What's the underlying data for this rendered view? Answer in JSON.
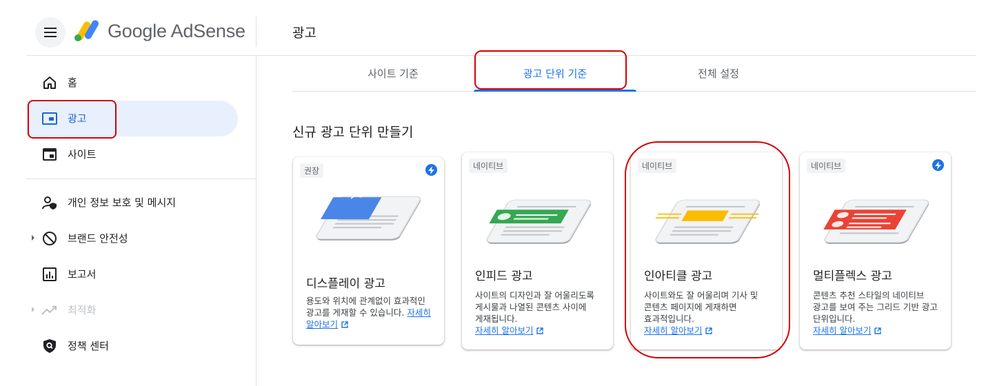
{
  "header": {
    "brand": "Google AdSense",
    "page_title": "광고"
  },
  "sidebar": {
    "items": [
      {
        "label": "홈",
        "icon": "home-icon",
        "active": false
      },
      {
        "label": "광고",
        "icon": "ads-icon",
        "active": true
      },
      {
        "label": "사이트",
        "icon": "sites-icon",
        "active": false
      },
      {
        "label": "개인 정보 보호 및 메시지",
        "icon": "privacy-icon",
        "active": false
      },
      {
        "label": "브랜드 안전성",
        "icon": "block-icon",
        "active": false
      },
      {
        "label": "보고서",
        "icon": "reports-icon",
        "active": false
      },
      {
        "label": "최적화",
        "icon": "trending-icon",
        "active": false,
        "disabled": true
      },
      {
        "label": "정책 센터",
        "icon": "policy-shield-icon",
        "active": false
      }
    ]
  },
  "tabs": [
    {
      "label": "사이트 기준",
      "active": false
    },
    {
      "label": "광고 단위 기준",
      "active": true
    },
    {
      "label": "전체 설정",
      "active": false
    }
  ],
  "section_title": "신규 광고 단위 만들기",
  "cards": [
    {
      "badge": "권장",
      "lightning": true,
      "title": "디스플레이 광고",
      "description": "용도와 위치에 관계없이 효과적인 광고를 게재할 수 있습니다.",
      "link": "자세히 알아보기",
      "accent": "#4a86e8"
    },
    {
      "badge": "네이티브",
      "lightning": false,
      "title": "인피드 광고",
      "description": "사이트의 디자인과 잘 어울리도록 게시물과 나열된 콘텐츠 사이에 게재됩니다.",
      "link": "자세히 알아보기",
      "accent": "#34a853"
    },
    {
      "badge": "네이티브",
      "lightning": false,
      "title": "인아티클 광고",
      "description": "사이트와도 잘 어울리며 기사 및 콘텐츠 페이지에 게재하면 효과적입니다.",
      "link": "자세히 알아보기",
      "accent": "#fbbc04"
    },
    {
      "badge": "네이티브",
      "lightning": true,
      "title": "멀티플렉스 광고",
      "description": "콘텐츠 추천 스타일의 네이티브 광고를 보여 주는 그리드 기반 광고 단위입니다.",
      "link": "자세히 알아보기",
      "accent": "#ea4335"
    }
  ],
  "colors": {
    "primary": "#1a73e8",
    "active_bg": "#e8f0fe",
    "annotation": "#d50000"
  }
}
